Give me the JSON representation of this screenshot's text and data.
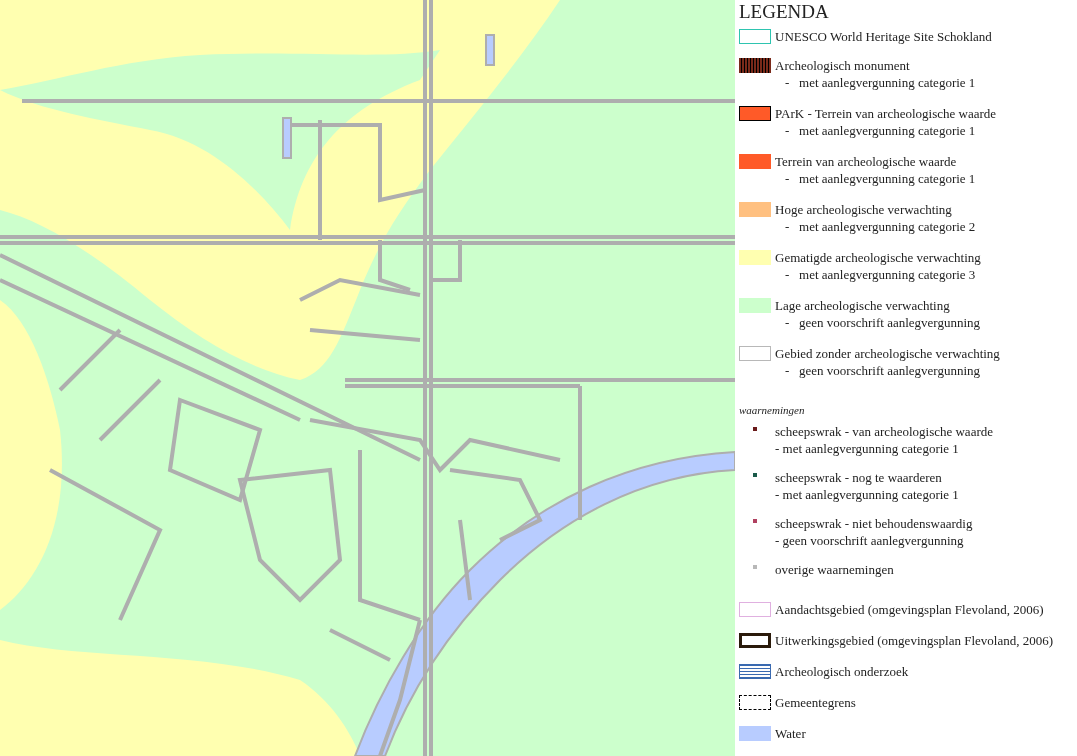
{
  "legend": {
    "title": "LEGENDA",
    "zones": [
      {
        "kind": "outline",
        "color": "#2ec4b0",
        "label": "UNESCO World Heritage Site Schokland"
      },
      {
        "kind": "hatched",
        "color": "#7a2a1a",
        "label": "Archeologisch monument",
        "note": "-   met aanlegvergunning categorie 1"
      },
      {
        "kind": "bordered",
        "color": "#ff5a28",
        "label": "PArK - Terrein van archeologische waarde",
        "note": "-   met aanlegvergunning categorie 1"
      },
      {
        "kind": "fill",
        "color": "#ff5a28",
        "label": "Terrein van archeologische waarde",
        "note": "-   met aanlegvergunning categorie 1"
      },
      {
        "kind": "fill",
        "color": "#ffc080",
        "label": "Hoge archeologische verwachting",
        "note": "-   met aanlegvergunning categorie 2"
      },
      {
        "kind": "fill",
        "color": "#ffffb0",
        "label": "Gematigde archeologische verwachting",
        "note": "-   met aanlegvergunning categorie 3"
      },
      {
        "kind": "fill",
        "color": "#ccffcc",
        "label": "Lage archeologische verwachting",
        "note": "-   geen voorschrift aanlegvergunning"
      },
      {
        "kind": "outline",
        "color": "#b8b8b8",
        "label": "Gebied zonder archeologische verwachting",
        "note": "-   geen voorschrift aanlegvergunning"
      }
    ],
    "observations_title": "waarnemingen",
    "observations": [
      {
        "color": "#6a1a1a",
        "label": "scheepswrak - van archeologische waarde",
        "note": "- met aanlegvergunning categorie 1"
      },
      {
        "color": "#1a5a4a",
        "label": "scheepswrak - nog te waarderen",
        "note": "- met aanlegvergunning categorie 1"
      },
      {
        "color": "#b04060",
        "label": "scheepswrak - niet behoudenswaardig",
        "note": "- geen voorschrift aanlegvergunning"
      },
      {
        "color": "#b8b8b8",
        "label": "overige waarnemingen"
      }
    ],
    "other": [
      {
        "kind": "outline",
        "color": "#e0b0e0",
        "label": "Aandachtsgebied (omgevingsplan Flevoland, 2006)"
      },
      {
        "kind": "thick",
        "color": "#2a1a0a",
        "label": "Uitwerkingsgebied (omgevingsplan Flevoland, 2006)"
      },
      {
        "kind": "striped",
        "color": "#3a6ab0",
        "label": "Archeologisch onderzoek"
      },
      {
        "kind": "dashed",
        "color": "#000000",
        "label": "Gemeentegrens"
      },
      {
        "kind": "fill",
        "color": "#b8ccff",
        "label": "Water"
      }
    ]
  }
}
